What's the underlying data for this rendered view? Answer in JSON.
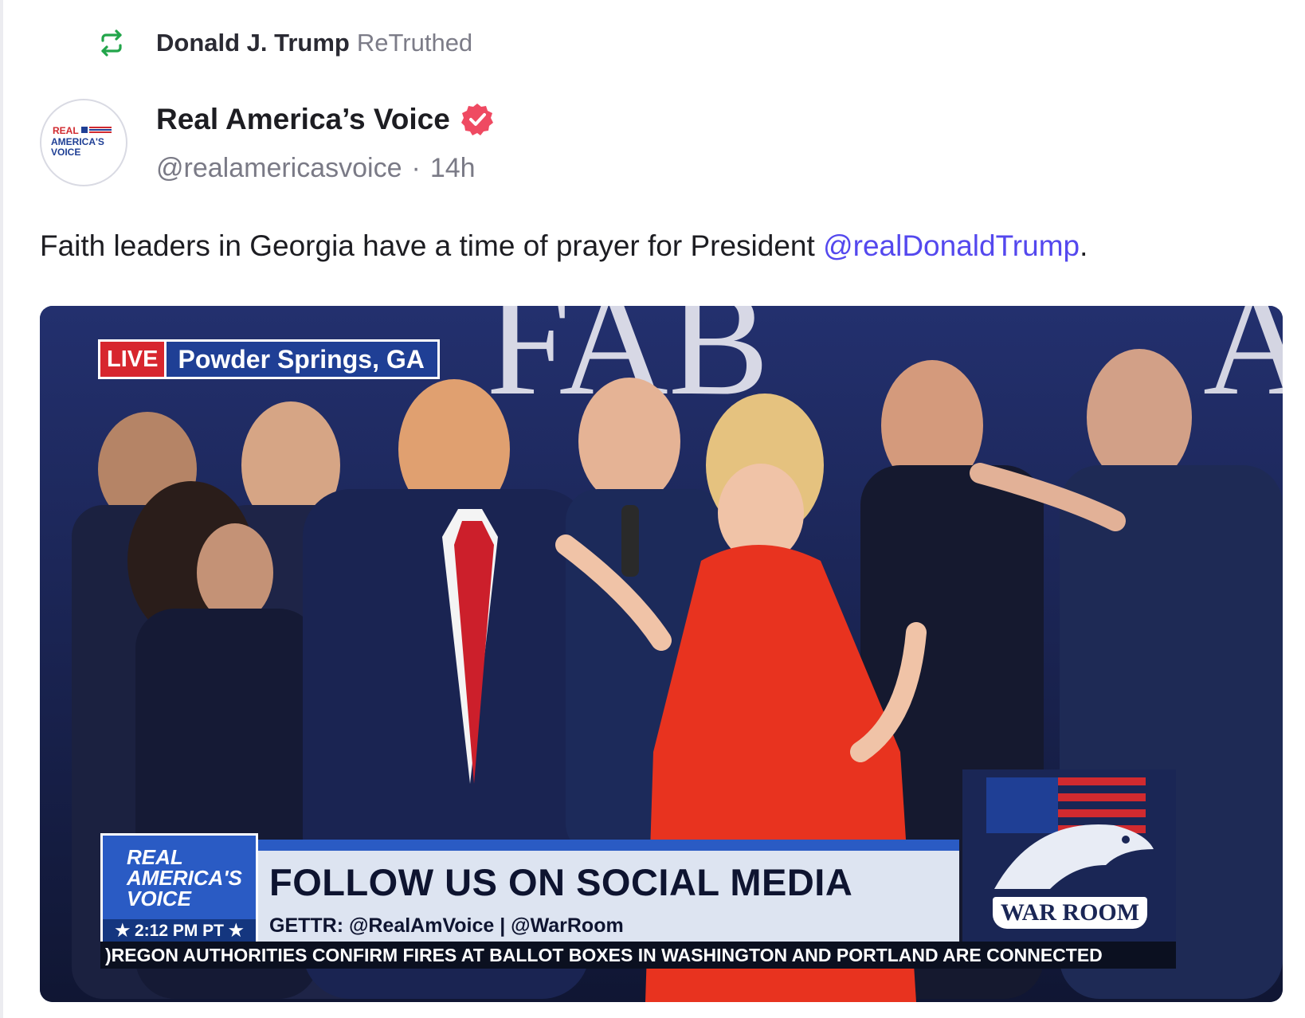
{
  "retruth": {
    "name": "Donald J. Trump",
    "action": "ReTruthed"
  },
  "author": {
    "display_name": "Real America’s Voice",
    "handle": "@realamericasvoice",
    "separator": "·",
    "time_ago": "14h",
    "avatar_text": "REAL AMERICA'S VOICE",
    "verified": true
  },
  "post": {
    "text_before": "Faith leaders in Georgia have a time of prayer for President ",
    "mention": "@realDonaldTrump",
    "text_after": "."
  },
  "media": {
    "live_tag": "LIVE",
    "location": "Powder Springs, GA",
    "backdrop_text": "FAB",
    "network_line1": "REAL",
    "network_line2": "AMERICA'S",
    "network_line3": "VOICE",
    "time": "★ 2:12 PM PT ★",
    "headline": "FOLLOW US ON SOCIAL MEDIA",
    "subline": "GETTR: @RealAmVoice  |  @WarRoom",
    "warroom_label": "WAR ROOM",
    "ticker": ")REGON AUTHORITIES CONFIRM FIRES AT BALLOT BOXES IN WASHINGTON AND PORTLAND ARE CONNECTED"
  },
  "colors": {
    "retruth_green": "#22a54a",
    "mention_blue": "#5448ee",
    "verified_pink": "#ef4a62",
    "live_red": "#d7262e",
    "network_blue": "#2a5bc4"
  },
  "icons": {
    "retruth": "retruth-icon",
    "verified": "verified-badge-icon"
  }
}
